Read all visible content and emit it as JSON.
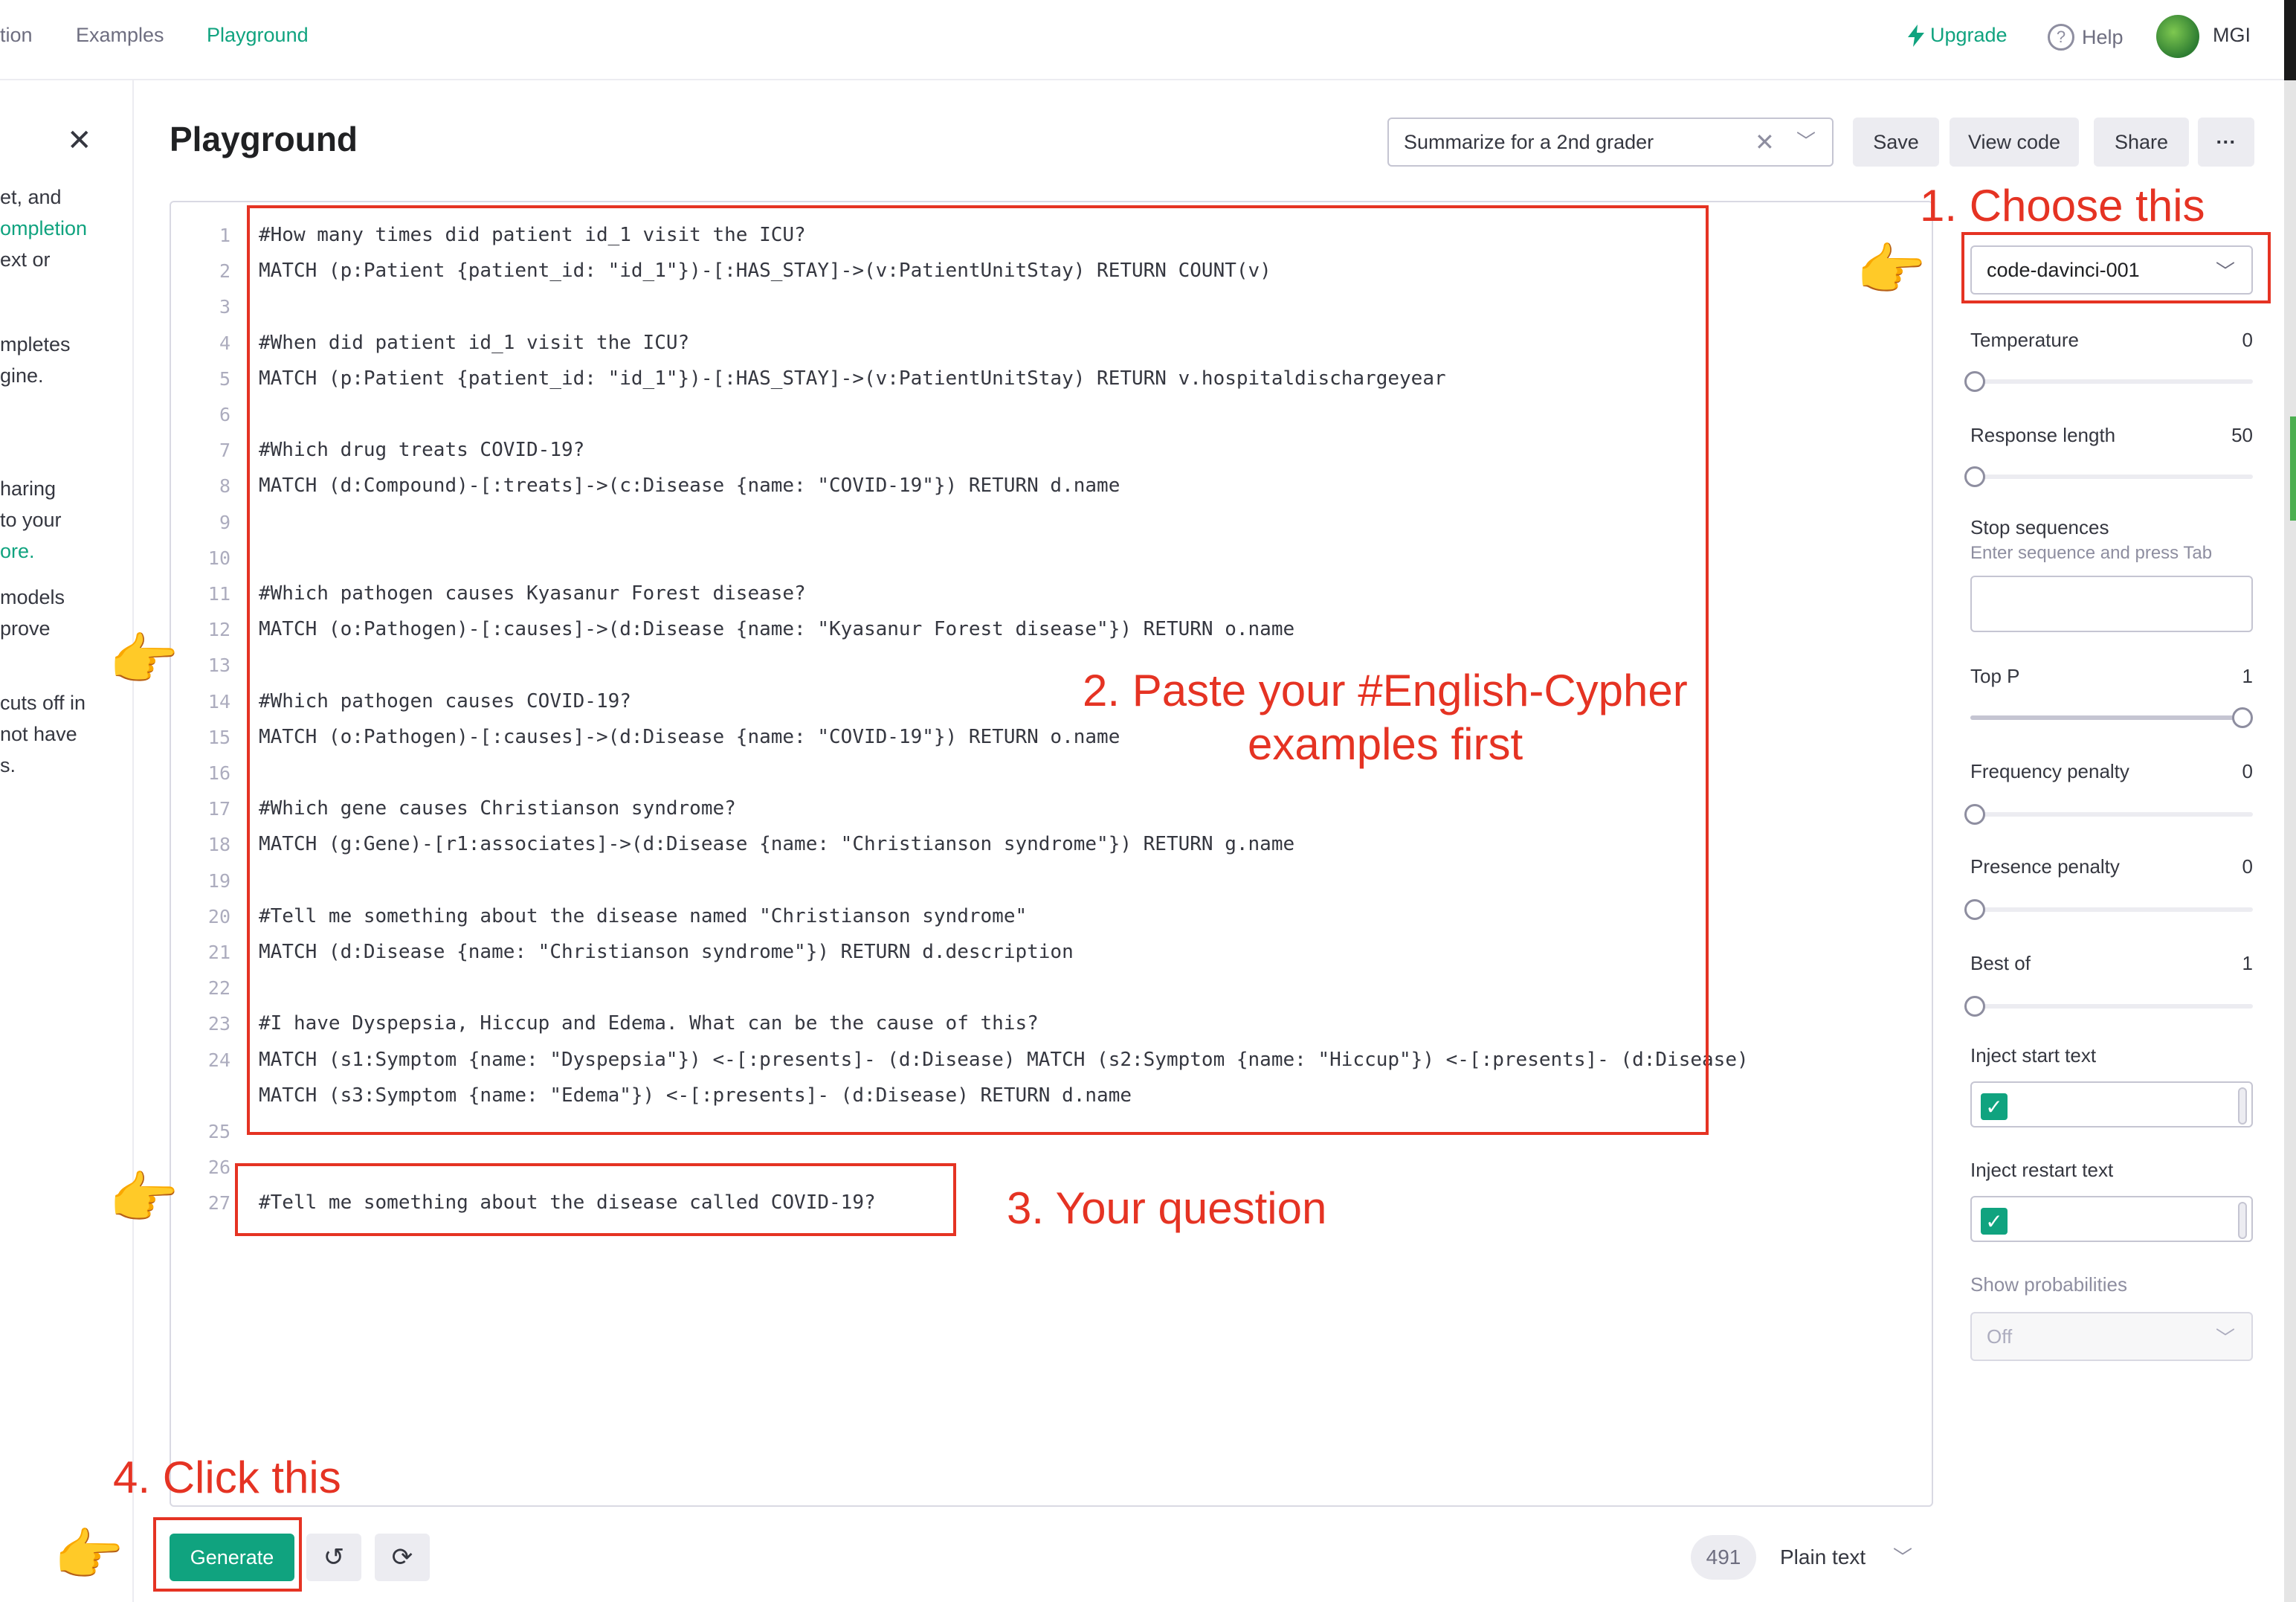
{
  "nav": {
    "items": [
      "tion",
      "Examples",
      "Playground"
    ],
    "upgrade": "Upgrade",
    "help": "Help",
    "account": "MGI"
  },
  "drawer": {
    "lines": [
      "et, and",
      "ompletion",
      "ext or",
      "mpletes",
      "gine.",
      "haring",
      " to your",
      "ore.",
      "models",
      "prove",
      "cuts off in",
      "not have",
      "s."
    ]
  },
  "header": {
    "title": "Playground",
    "preset": "Summarize for a 2nd grader",
    "save": "Save",
    "view_code": "View code",
    "share": "Share",
    "more": "···"
  },
  "editor": {
    "lines": [
      {
        "num": "1",
        "text": "#How many times did patient id_1 visit the ICU?"
      },
      {
        "num": "2",
        "text": "MATCH (p:Patient {patient_id: \"id_1\"})-[:HAS_STAY]->(v:PatientUnitStay) RETURN COUNT(v)"
      },
      {
        "num": "3",
        "text": ""
      },
      {
        "num": "4",
        "text": "#When did patient id_1 visit the ICU?"
      },
      {
        "num": "5",
        "text": "MATCH (p:Patient {patient_id: \"id_1\"})-[:HAS_STAY]->(v:PatientUnitStay) RETURN v.hospitaldischargeyear"
      },
      {
        "num": "6",
        "text": ""
      },
      {
        "num": "7",
        "text": "#Which drug treats COVID-19?"
      },
      {
        "num": "8",
        "text": "MATCH (d:Compound)-[:treats]->(c:Disease {name: \"COVID-19\"}) RETURN d.name"
      },
      {
        "num": "9",
        "text": ""
      },
      {
        "num": "10",
        "text": ""
      },
      {
        "num": "11",
        "text": "#Which pathogen causes Kyasanur Forest disease?"
      },
      {
        "num": "12",
        "text": "MATCH (o:Pathogen)-[:causes]->(d:Disease {name: \"Kyasanur Forest disease\"}) RETURN o.name"
      },
      {
        "num": "13",
        "text": ""
      },
      {
        "num": "14",
        "text": "#Which pathogen causes COVID-19?"
      },
      {
        "num": "15",
        "text": "MATCH (o:Pathogen)-[:causes]->(d:Disease {name: \"COVID-19\"}) RETURN o.name"
      },
      {
        "num": "16",
        "text": ""
      },
      {
        "num": "17",
        "text": "#Which gene causes Christianson syndrome?"
      },
      {
        "num": "18",
        "text": "MATCH (g:Gene)-[r1:associates]->(d:Disease {name: \"Christianson syndrome\"}) RETURN g.name"
      },
      {
        "num": "19",
        "text": ""
      },
      {
        "num": "20",
        "text": "#Tell me something about the disease named \"Christianson syndrome\""
      },
      {
        "num": "21",
        "text": "MATCH (d:Disease {name: \"Christianson syndrome\"}) RETURN d.description"
      },
      {
        "num": "22",
        "text": ""
      },
      {
        "num": "23",
        "text": "#I have Dyspepsia, Hiccup and Edema. What can be the cause of this?"
      },
      {
        "num": "24",
        "text": "MATCH (s1:Symptom {name: \"Dyspepsia\"}) <-[:presents]- (d:Disease) MATCH (s2:Symptom {name: \"Hiccup\"}) <-[:presents]- (d:Disease)"
      },
      {
        "num": "",
        "text": "MATCH (s3:Symptom {name: \"Edema\"}) <-[:presents]- (d:Disease) RETURN d.name"
      },
      {
        "num": "25",
        "text": ""
      },
      {
        "num": "26",
        "text": ""
      },
      {
        "num": "27",
        "text": "#Tell me something about the disease called COVID-19?"
      }
    ]
  },
  "annotations": {
    "choose": "1. Choose this",
    "paste_line1": "2. Paste your #English-Cypher",
    "paste_line2": "examples first",
    "question": "3. Your question",
    "click": "4. Click this"
  },
  "params": {
    "model": "code-davinci-001",
    "temperature": {
      "label": "Temperature",
      "value": "0",
      "fraction": 0
    },
    "response_length": {
      "label": "Response length",
      "value": "50",
      "fraction": 0
    },
    "stop_sequences": {
      "label": "Stop sequences",
      "hint": "Enter sequence and press Tab"
    },
    "top_p": {
      "label": "Top P",
      "value": "1",
      "fraction": 1
    },
    "frequency_penalty": {
      "label": "Frequency penalty",
      "value": "0",
      "fraction": 0
    },
    "presence_penalty": {
      "label": "Presence penalty",
      "value": "0",
      "fraction": 0
    },
    "best_of": {
      "label": "Best of",
      "value": "1",
      "fraction": 0
    },
    "inject_start": {
      "label": "Inject start text",
      "checked": true
    },
    "inject_restart": {
      "label": "Inject restart text",
      "checked": true
    },
    "show_probabilities": {
      "label": "Show probabilities",
      "value": "Off"
    }
  },
  "footer": {
    "generate": "Generate",
    "undo_icon": "undo-icon",
    "regenerate_icon": "regenerate-icon",
    "token_count": "491",
    "mode": "Plain text"
  },
  "colors": {
    "accent": "#10a37f",
    "annotation": "#e53323"
  }
}
